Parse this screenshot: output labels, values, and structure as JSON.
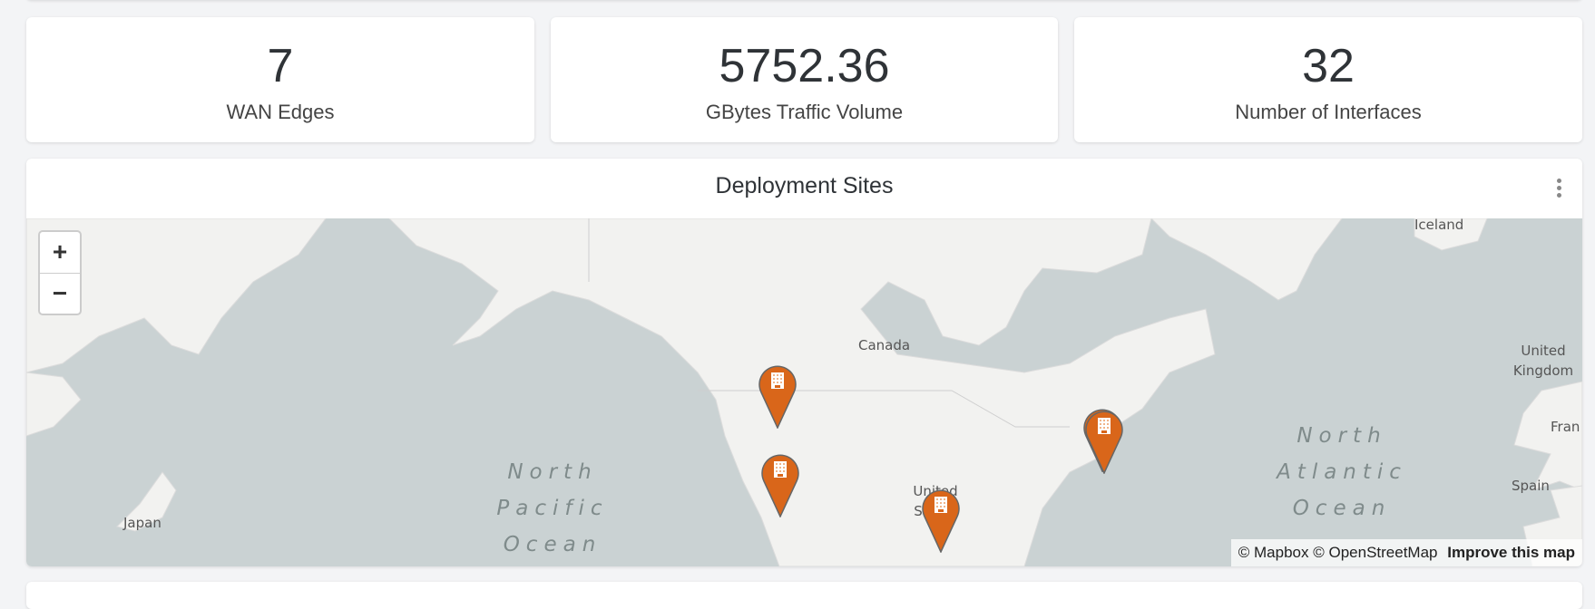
{
  "stats": [
    {
      "value": "7",
      "label": "WAN Edges"
    },
    {
      "value": "5752.36",
      "label": "GBytes Traffic Volume"
    },
    {
      "value": "32",
      "label": "Number of Interfaces"
    }
  ],
  "map_panel": {
    "title": "Deployment Sites",
    "menu_icon": "more-vertical-icon",
    "zoom_in": "+",
    "zoom_out": "−",
    "labels": {
      "iceland": "Iceland",
      "canada": "Canada",
      "uk": "United Kingdom",
      "france": "Fran",
      "spain": "Spain",
      "japan": "Japan",
      "us": "United States",
      "pacific": "North Pacific Ocean",
      "atlantic": "North Atlantic Ocean"
    },
    "attribution": {
      "mapbox": "© Mapbox",
      "osm": "© OpenStreetMap",
      "improve": "Improve this map"
    },
    "marker_color": "#D9661A",
    "marker_icon": "building-icon"
  },
  "colors": {
    "water": "#CAD2D3",
    "land": "#F2F2F0",
    "marker": "#D9661A"
  }
}
